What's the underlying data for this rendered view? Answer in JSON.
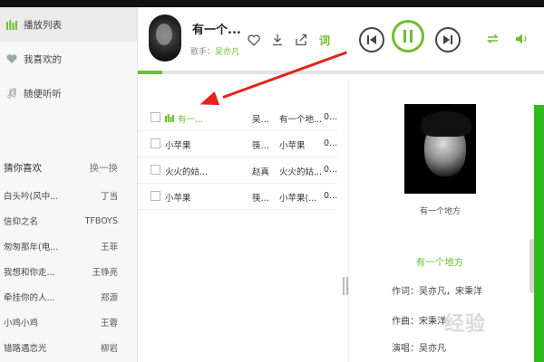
{
  "sidebar": {
    "nav": [
      {
        "label": "播放列表",
        "icon": "bars-icon"
      },
      {
        "label": "我喜欢的",
        "icon": "heart-icon"
      },
      {
        "label": "随便听听",
        "icon": "note-icon"
      }
    ],
    "section_title": "猜你喜欢",
    "refresh_label": "换一换",
    "recommendations": [
      {
        "title": "白头吟(风中...",
        "artist": "丁当"
      },
      {
        "title": "信仰之名",
        "artist": "TFBOYS"
      },
      {
        "title": "匆匆那年(电...",
        "artist": "王菲"
      },
      {
        "title": "我想和你走...",
        "artist": "王铮亮"
      },
      {
        "title": "牵挂你的人...",
        "artist": "郑源"
      },
      {
        "title": "小鸡小鸡",
        "artist": "王蓉"
      },
      {
        "title": "错路遇恋光",
        "artist": "柳岩"
      }
    ]
  },
  "player": {
    "title": "有一个...",
    "singer_prefix": "歌手：",
    "singer": "吴亦凡",
    "lyric_label": "词",
    "progress": 0.06
  },
  "playlist": [
    {
      "title": "有一...",
      "artist": "吴亦凡",
      "album": "有一个地...",
      "duration": "0...",
      "playing": true
    },
    {
      "title": "小苹果",
      "artist": "筷子...",
      "album": "小苹果",
      "duration": "0...",
      "playing": false
    },
    {
      "title": "火火的姑...",
      "artist": "赵真",
      "album": "火火的姑...",
      "duration": "0...",
      "playing": false
    },
    {
      "title": "小苹果",
      "artist": "筷子...",
      "album": "小苹果(...",
      "duration": "0...",
      "playing": false
    }
  ],
  "info": {
    "album_caption": "有一个地方",
    "song_title": "有一个地方",
    "lyricist": "作词：吴亦凡，宋秉洋",
    "composer": "作曲：宋秉洋",
    "singer": "演唱：吴亦凡"
  },
  "watermark": "经验",
  "colors": {
    "accent": "#6cbf2d",
    "arrow": "#e2241b",
    "right_bar": "#2dbb1e"
  }
}
